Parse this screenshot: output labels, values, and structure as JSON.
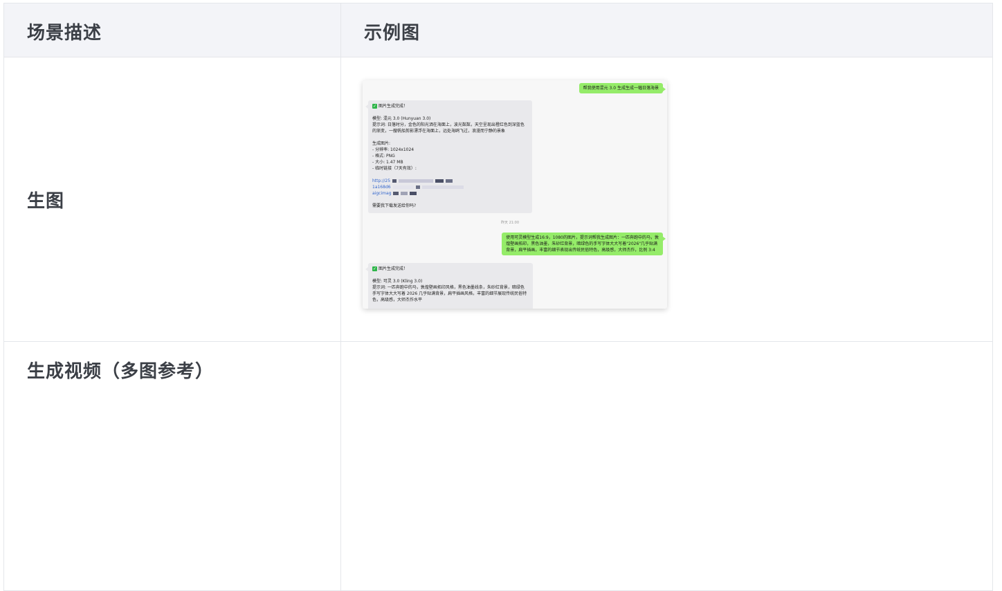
{
  "table": {
    "headers": [
      "场景描述",
      "示例图"
    ],
    "rows": [
      {
        "label": "生图"
      },
      {
        "label": "生成视频（多图参考）"
      }
    ]
  },
  "chat": {
    "msg1": "帮我使用混元 3.0 生成生成一幅日落海景",
    "reply1": {
      "title": "图片生成完成！",
      "lines": [
        "模型: 混元 3.0 (Hunyuan 3.0)",
        "提示词: 日落时分，金色的阳光洒在海面上，波光粼粼，天空呈现出橙红色到深蓝色",
        "的渐变，一艘帆船剪影漂浮在海面上，远处海鸥飞过，浪漫而宁静的景象",
        "生成图片:",
        "- 分辨率: 1024x1024",
        "- 格式: PNG",
        "- 大小: 1.47 MB",
        "- 临时链接（7天有效）:"
      ],
      "links": [
        "http://25",
        "1a168d6",
        "aigcimag"
      ],
      "question": "需要我下载发送给你吗?"
    },
    "timestamp": "昨天 21:00",
    "msg2": [
      "使用可灵模型生成16:9，1080的图片，提示词帮我生成图片：一匹奔跑中的马，敦",
      "煌壁画拓印，黑色油墨，朱砂红背景，暗绿色的手写字体大大写着\"2026\"几乎贴满",
      "背景，扁平插画，丰富的细节表现出传统民俗特色，高级感，大师杰作，比例 3:4"
    ],
    "reply2": {
      "title": "图片生成完成！",
      "lines": [
        "模型: 可灵 3.0 (Kling 3.0)",
        "提示词: 一匹奔跑中的马，敦煌壁画拓印风格，黑色油墨线条，朱砂红背景，暗绿色",
        "手写字体大大写着 2026 几乎贴满背景，扁平插画风格，丰富的细节展现传统民俗特",
        "色，高级感，大师杰作水平"
      ]
    }
  },
  "colors": {
    "header_bg": "#f3f4f8",
    "border": "#e4e6ea",
    "bubble_me": "#95ec69",
    "bubble_bot": "#e9e9ec"
  }
}
